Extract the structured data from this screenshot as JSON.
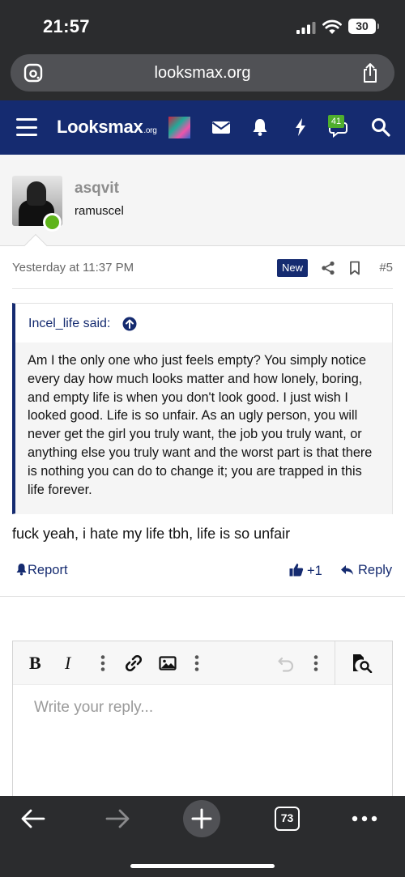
{
  "status": {
    "time": "21:57",
    "battery": "30"
  },
  "browser": {
    "url": "looksmax.org",
    "tab_count": "73"
  },
  "site": {
    "logo_main": "Looksmax",
    "logo_suffix": ".org",
    "notif_badge": "41"
  },
  "post": {
    "username": "asqvit",
    "user_title": "ramuscel",
    "date": "Yesterday at 11:37 PM",
    "new_label": "New",
    "post_number": "#5",
    "quote": {
      "author_said": "Incel_life said:",
      "text": "Am I the only one who just feels empty? You simply notice every day how much looks matter and how lonely, boring, and empty life is when you don't look good. I just wish I looked good. Life is so unfair. As an ugly person, you will never get the girl you truly want, the job you truly want, or anything else you truly want and the worst part is that there is nothing you can do to change it; you are trapped in this life forever."
    },
    "reply_text": "fuck yeah, i hate my life tbh, life is so unfair",
    "actions": {
      "report": "Report",
      "like_count": "+1",
      "reply": "Reply"
    }
  },
  "editor": {
    "bold": "B",
    "italic": "I",
    "placeholder": "Write your reply..."
  },
  "colors": {
    "brand": "#152b70",
    "browser_chrome": "#2b2c2e",
    "online": "#5fb41b"
  }
}
